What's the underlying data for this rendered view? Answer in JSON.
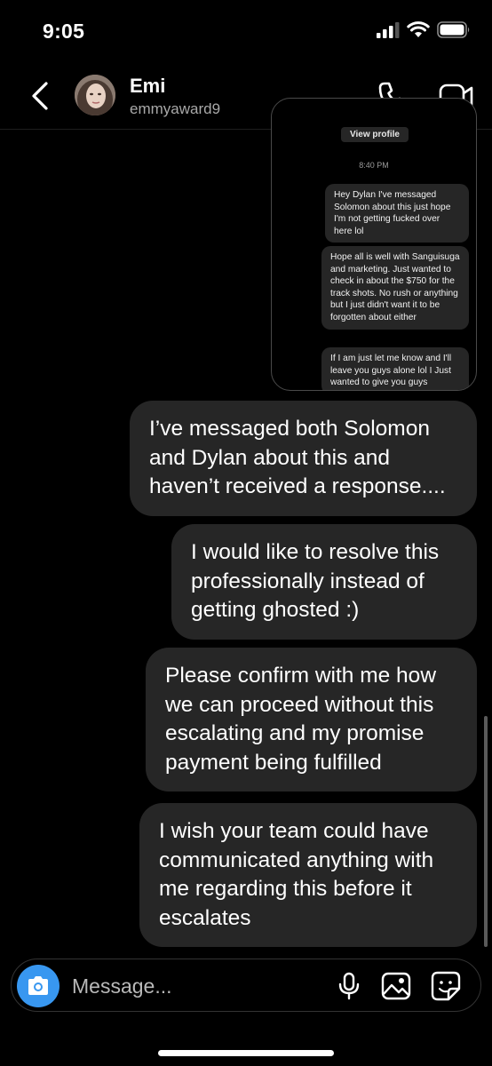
{
  "status_bar": {
    "time": "9:05",
    "icons": [
      "cellular-signal-icon",
      "wifi-icon",
      "battery-icon"
    ]
  },
  "header": {
    "contact_name": "Emi",
    "contact_handle": "emmyaward9",
    "icons": [
      "back-chevron-icon",
      "phone-call-icon",
      "video-call-icon"
    ]
  },
  "embedded_screenshot": {
    "view_profile_label": "View profile",
    "timestamp": "8:40 PM",
    "messages": [
      "Hey Dylan I've messaged Solomon about this just hope I'm not getting fucked over here lol",
      "Hope all is well with Sanguisuga and marketing. Just wanted to check in about the $750 for the track shots. No rush or anything but I just didn't want it to be forgotten about either",
      "If I am just let me know and I'll leave you guys alone lol I Just wanted to give you guys"
    ]
  },
  "messages": [
    {
      "text": "I’ve messaged both Solomon and Dylan about this and haven’t received a response...."
    },
    {
      "text": "I would like to resolve this professionally instead of getting ghosted :)"
    },
    {
      "text": "Please confirm with me how we can proceed without this escalating and my promise payment being fulfilled"
    },
    {
      "text": "I wish your team could have communicated anything with me regarding this before it escalates"
    }
  ],
  "composer": {
    "placeholder": "Message...",
    "icons": [
      "camera-icon",
      "microphone-icon",
      "gallery-icon",
      "sticker-icon"
    ]
  },
  "colors": {
    "background": "#000000",
    "bubble": "#262626",
    "accent": "#3897f0",
    "secondary_text": "#a8a8a8"
  }
}
